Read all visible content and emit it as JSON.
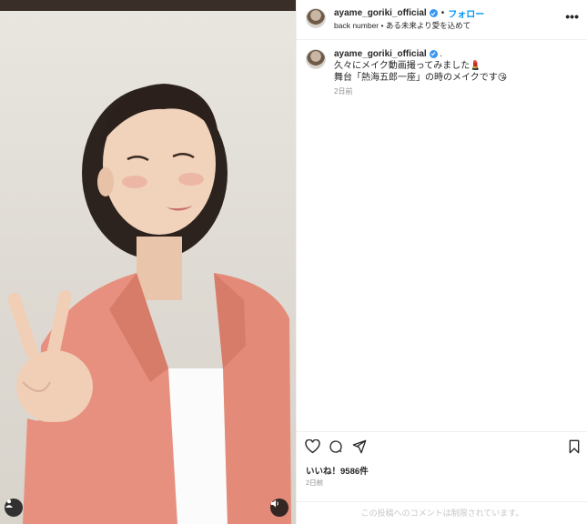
{
  "header": {
    "username": "ayame_goriki_official",
    "separator": "•",
    "follow_label": "フォロー",
    "audio": "back number • ある未来より愛を込めて",
    "more": "•••"
  },
  "caption": {
    "username": "ayame_goriki_official",
    "line1": "久々にメイク動画撮ってみました💄",
    "line2": "舞台「熱海五郎一座」の時のメイクです😘",
    "dot": ".",
    "time": "2日前"
  },
  "engagement": {
    "likes": "いいね！9586件",
    "time": "2日前",
    "comments_disabled": "この投稿へのコメントは制限されています。"
  },
  "icons": {
    "like": "heart-icon",
    "comment": "comment-icon",
    "share": "share-icon",
    "save": "bookmark-icon",
    "tags": "user-icon",
    "audio": "speaker-icon",
    "verified": "verified-badge-icon"
  },
  "colors": {
    "link": "#0095f6",
    "verified": "#3897f0",
    "muted": "#8e8e8e",
    "jacket": "#e8907f"
  }
}
